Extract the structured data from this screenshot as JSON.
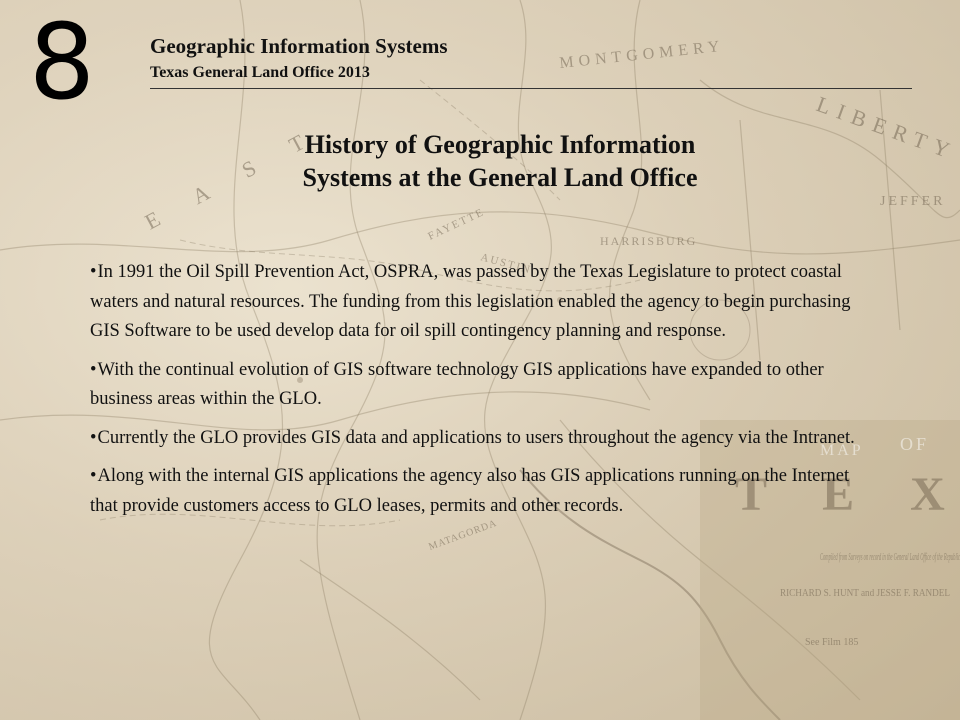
{
  "slide": {
    "number": "8"
  },
  "header": {
    "title": "Geographic Information Systems",
    "subtitle": "Texas General Land Office 2013"
  },
  "title": {
    "line1": "History of Geographic Information",
    "line2": "Systems at the General Land Office"
  },
  "bullets": [
    {
      "marker": "•",
      "text": "In 1991 the Oil Spill Prevention Act, OSPRA, was passed by the Texas Legislature to protect coastal waters and natural resources.  The funding from this legislation enabled the agency to begin purchasing GIS Software to be used develop data for oil spill contingency planning and response."
    },
    {
      "marker": "•",
      "text": "With the continual evolution of GIS software technology GIS applications have expanded to other business areas within the GLO."
    },
    {
      "marker": "•",
      "text": "Currently the GLO provides GIS data and applications to users throughout the agency via the Intranet."
    },
    {
      "marker": "•",
      "text": "Along with the internal GIS applications the agency also has GIS applications running on the Internet that provide customers access to GLO leases, permits and other records."
    }
  ],
  "background_map": {
    "labels": [
      "MONTGOMERY",
      "LIBERTY",
      "JEFFER",
      "HARRISBURG",
      "AUSTIN",
      "FAYETTE",
      "MATAGORDA",
      "E A S T",
      "MAP",
      "OF",
      "T E X A S",
      "Compiled from Surveys on record in the General Land Office of the Republic",
      "RICHARD S. HUNT and JESSE F. RANDEL",
      "See Film 185"
    ]
  }
}
